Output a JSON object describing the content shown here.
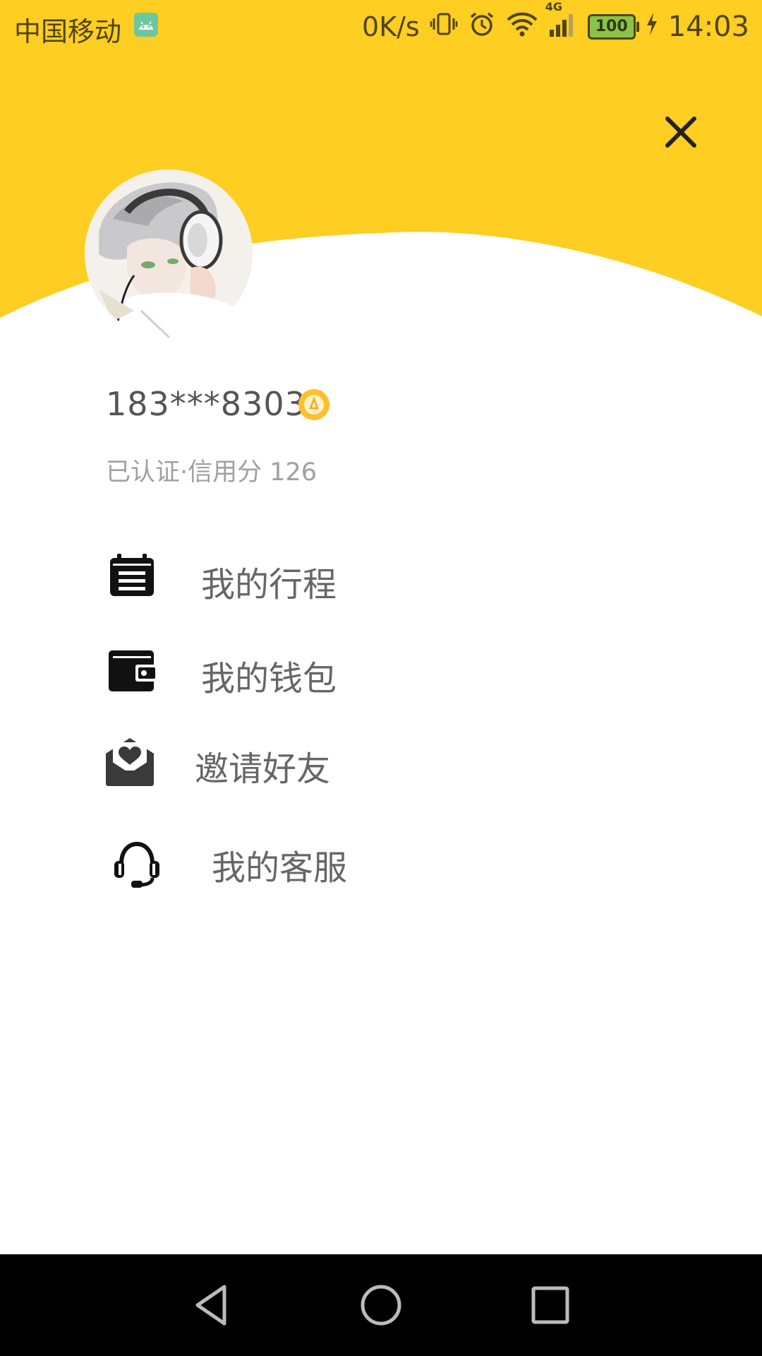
{
  "status_bar": {
    "carrier": "中国移动",
    "speed": "0K/s",
    "network": "4G",
    "battery": "100",
    "time": "14:03"
  },
  "profile": {
    "phone": "183***8303",
    "credit": "已认证·信用分 126"
  },
  "menu": [
    {
      "label": "我的行程",
      "icon": "calendar-icon"
    },
    {
      "label": "我的钱包",
      "icon": "wallet-icon"
    },
    {
      "label": "邀请好友",
      "icon": "invite-mail-icon"
    },
    {
      "label": "我的客服",
      "icon": "headset-icon"
    }
  ],
  "colors": {
    "header_yellow": "#FECE22",
    "text_primary": "#555555",
    "text_secondary": "#A0A0A0",
    "icon": "#111111"
  }
}
